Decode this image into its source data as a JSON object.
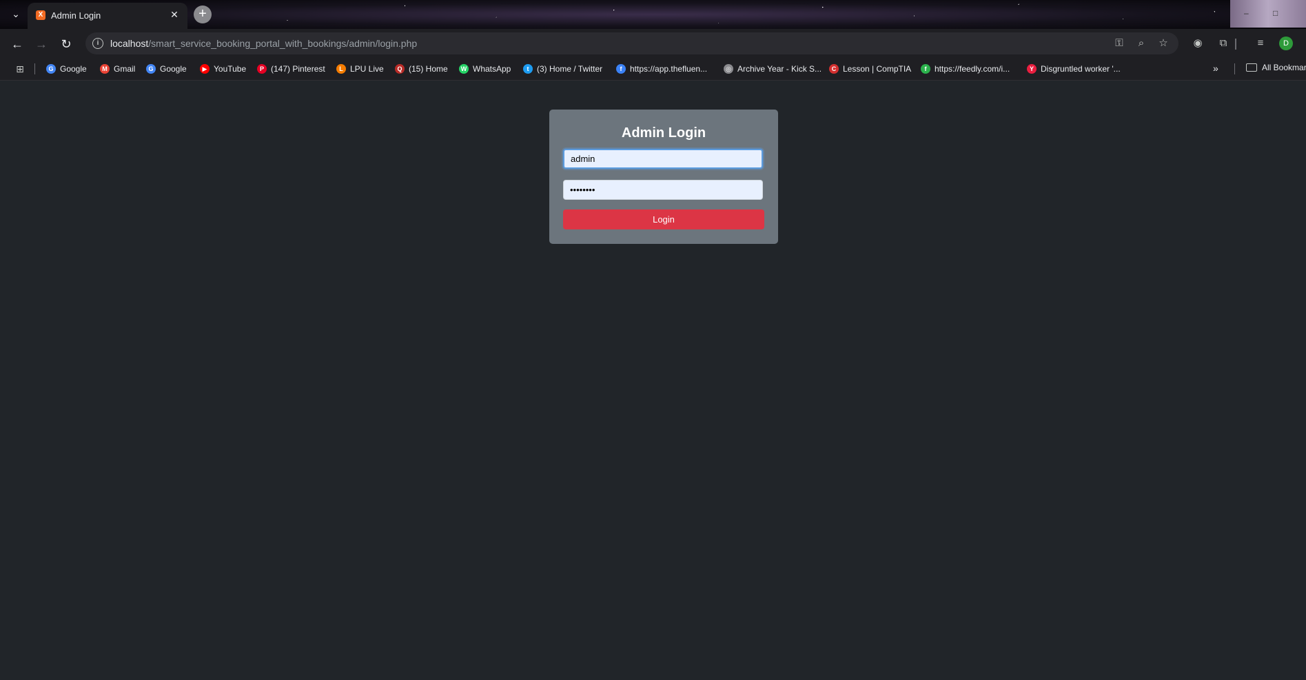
{
  "browser": {
    "tab": {
      "title": "Admin Login",
      "favicon_letter": "X"
    },
    "url_host": "localhost",
    "url_path": "/smart_service_booking_portal_with_bookings/admin/login.php",
    "profile_initial": "D"
  },
  "bookmarks": {
    "items": [
      {
        "label": "Google",
        "icon": "google-icon",
        "color": "#4285f4",
        "glyph": "G"
      },
      {
        "label": "Gmail",
        "icon": "gmail-icon",
        "color": "#ea4335",
        "glyph": "M"
      },
      {
        "label": "Google",
        "icon": "google-icon",
        "color": "#4285f4",
        "glyph": "G"
      },
      {
        "label": "YouTube",
        "icon": "youtube-icon",
        "color": "#ff0000",
        "glyph": "▶"
      },
      {
        "label": "(147) Pinterest",
        "icon": "pinterest-icon",
        "color": "#e60023",
        "glyph": "P"
      },
      {
        "label": "LPU Live",
        "icon": "lpu-live-icon",
        "color": "#f57c00",
        "glyph": "L"
      },
      {
        "label": "(15) Home",
        "icon": "quora-icon",
        "color": "#b92b27",
        "glyph": "Q"
      },
      {
        "label": "WhatsApp",
        "icon": "whatsapp-icon",
        "color": "#25d366",
        "glyph": "W"
      },
      {
        "label": "(3) Home / Twitter",
        "icon": "twitter-icon",
        "color": "#1d9bf0",
        "glyph": "t"
      },
      {
        "label": "https://app.thefluen...",
        "icon": "fluent-icon",
        "color": "#3b82f6",
        "glyph": "f"
      },
      {
        "label": "Archive Year - Kick S...",
        "icon": "globe-icon",
        "color": "#8a8a8e",
        "glyph": "◎"
      },
      {
        "label": "Lesson | CompTIA",
        "icon": "comptia-icon",
        "color": "#d32f2f",
        "glyph": "C"
      },
      {
        "label": "https://feedly.com/i...",
        "icon": "feedly-icon",
        "color": "#2bb24c",
        "glyph": "f"
      },
      {
        "label": "Disgruntled worker '...",
        "icon": "yc-icon",
        "color": "#e91e3f",
        "glyph": "Y"
      }
    ],
    "all_bookmarks": "All Bookmarks"
  },
  "login": {
    "title": "Admin Login",
    "username_value": "admin",
    "password_value": "password",
    "button_label": "Login"
  },
  "colors": {
    "page_bg": "#212529",
    "card_bg": "#6c757d",
    "button_bg": "#dc3545",
    "input_bg": "#e8f0fe"
  }
}
